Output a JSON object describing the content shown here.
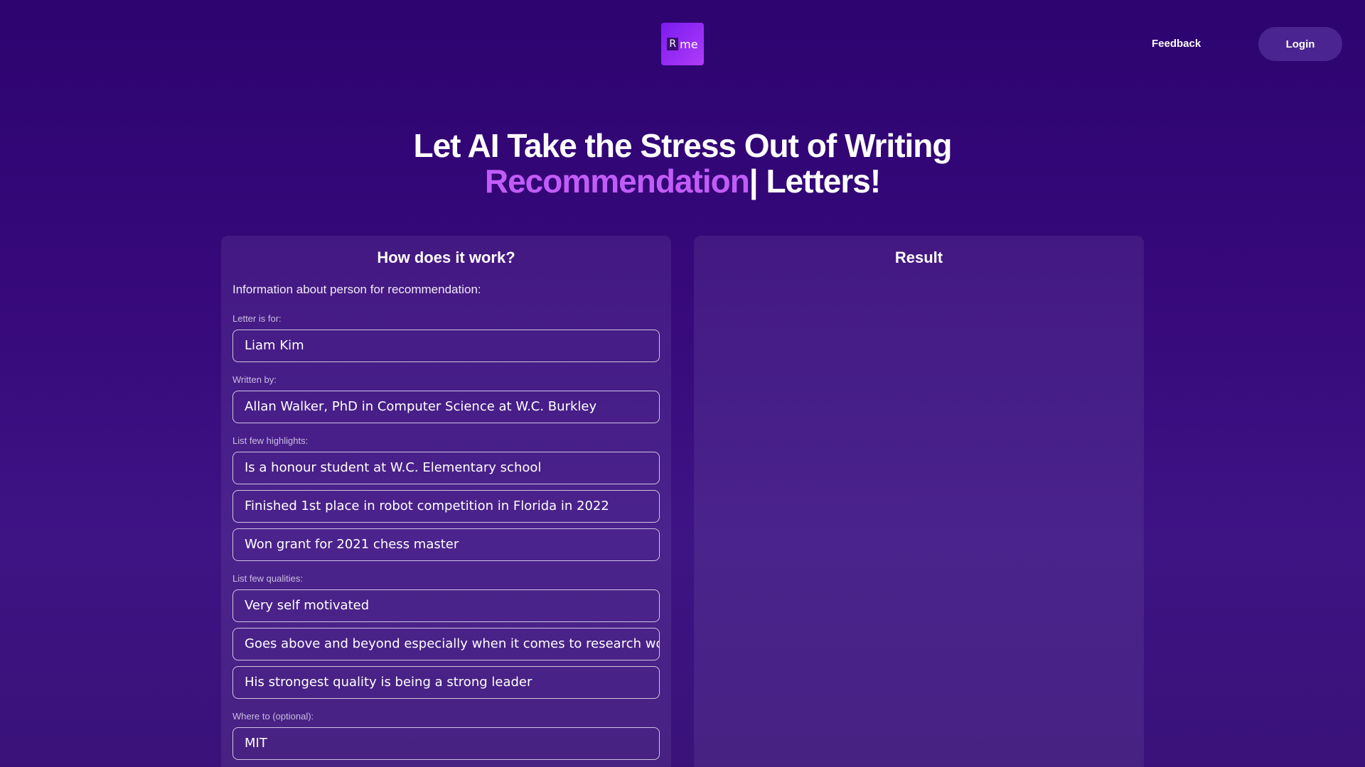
{
  "header": {
    "logo_text_r": "R",
    "logo_text_me": "me",
    "feedback_label": "Feedback",
    "login_label": "Login"
  },
  "hero": {
    "line1": "Let AI Take the Stress Out of Writing",
    "accent_word": "Recommendation",
    "cursor": "|",
    "line2_rest": " Letters!"
  },
  "form": {
    "title": "How does it work?",
    "intro": "Information about person for recommendation:",
    "letter_for_label": "Letter is for:",
    "letter_for_value": "Liam Kim",
    "written_by_label": "Written by:",
    "written_by_value": "Allan Walker, PhD in Computer Science at W.C. Burkley",
    "highlights_label": "List few highlights:",
    "highlights": [
      "Is a honour student at W.C. Elementary school",
      "Finished 1st place in robot competition in Florida in 2022",
      "Won grant for 2021 chess master"
    ],
    "qualities_label": "List few qualities:",
    "qualities": [
      "Very self motivated",
      "Goes above and beyond especially when it comes to research work",
      "His strongest quality is being a strong leader"
    ],
    "where_to_label": "Where to (optional):",
    "where_to_value": "MIT"
  },
  "result": {
    "title": "Result"
  }
}
